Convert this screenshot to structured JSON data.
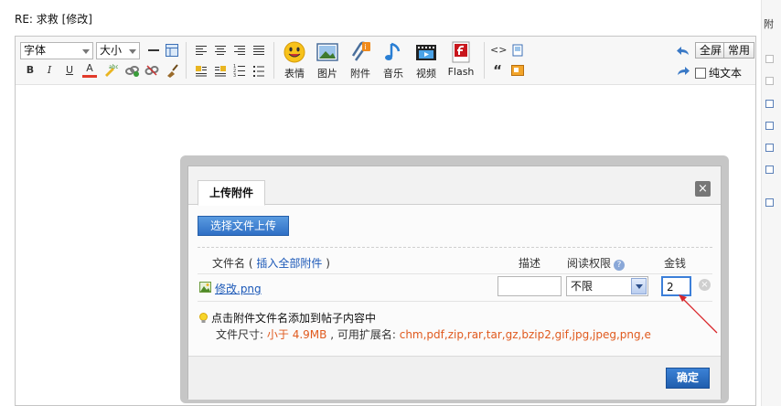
{
  "subject": "RE: 求救 [修改]",
  "toolbar": {
    "font_select": "字体",
    "size_select": "大小",
    "buttons": {
      "emoticon": "表情",
      "image": "图片",
      "attachment": "附件",
      "music": "音乐",
      "video": "视频",
      "flash": "Flash"
    },
    "fullscreen": "全屏",
    "common": "常用",
    "plain_text": "纯文本",
    "quote_glyph": "“",
    "bold": "B",
    "italic": "I",
    "underline": "U",
    "color": "A",
    "code_glyph": "<>"
  },
  "dialog": {
    "tab": "上传附件",
    "close": "×",
    "upload_button": "选择文件上传",
    "headers": {
      "file_name": "文件名",
      "paren_open": "(",
      "insert_all": "插入全部附件",
      "paren_close": ")",
      "description": "描述",
      "read_perm": "阅读权限",
      "help": "?",
      "money": "金钱"
    },
    "file": {
      "name": "修改.png",
      "description": "",
      "permission": "不限",
      "money": "2"
    },
    "delete_glyph": "×",
    "tip": "点击附件文件名添加到帖子内容中",
    "size_label": "文件尺寸:",
    "size_value": "小于 4.9MB",
    "ext_label": ", 可用扩展名:",
    "extensions": "chm,pdf,zip,rar,tar,gz,bzip2,gif,jpg,jpeg,png,e",
    "ok": "确定"
  },
  "right_strip": {
    "top_char": "附"
  },
  "colors": {
    "accent": "#2f6fc5",
    "link": "#1b58b8",
    "highlight": "#e05a1e",
    "annotation_arrow": "#d9262b"
  }
}
